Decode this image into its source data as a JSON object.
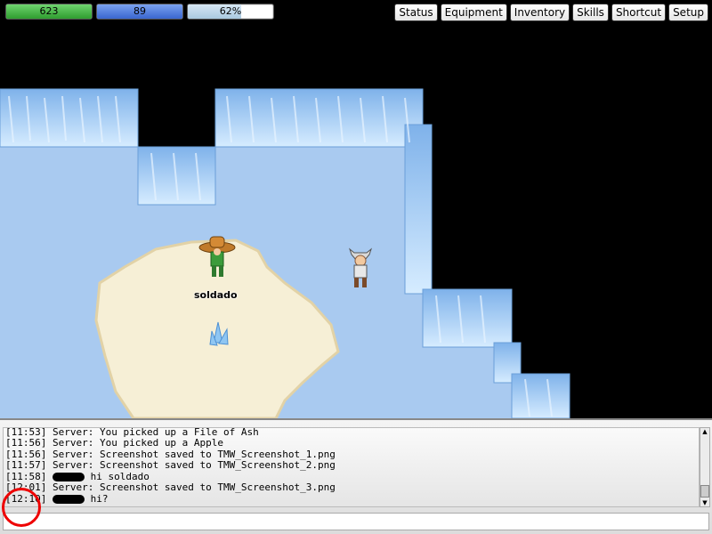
{
  "status": {
    "hp": {
      "label": "623",
      "fill": 1.0
    },
    "mp": {
      "label": "89",
      "fill": 1.0
    },
    "xp": {
      "label": "62%",
      "fill": 0.62
    }
  },
  "menu": {
    "status": "Status",
    "equipment": "Equipment",
    "inventory": "Inventory",
    "skills": "Skills",
    "shortcut": "Shortcut",
    "setup": "Setup"
  },
  "player": {
    "name": "soldado"
  },
  "chat": {
    "lines": [
      {
        "time": "[11:53]",
        "text": "Server: You picked up a File of Ash"
      },
      {
        "time": "[11:56]",
        "text": "Server: You picked up a Apple"
      },
      {
        "time": "[11:56]",
        "text": "Server: Screenshot saved to TMW_Screenshot_1.png"
      },
      {
        "time": "[11:57]",
        "text": "Server: Screenshot saved to TMW_Screenshot_2.png"
      },
      {
        "time": "[11:58]",
        "text": "hi soldado"
      },
      {
        "time": "[12:01]",
        "text": "Server: Screenshot saved to TMW_Screenshot_3.png"
      },
      {
        "time": "[12:10]",
        "text": "hi?"
      }
    ]
  },
  "colors": {
    "ice": "#a7c8ee",
    "sand": "#f6efd6",
    "highlight": "#e00000"
  }
}
